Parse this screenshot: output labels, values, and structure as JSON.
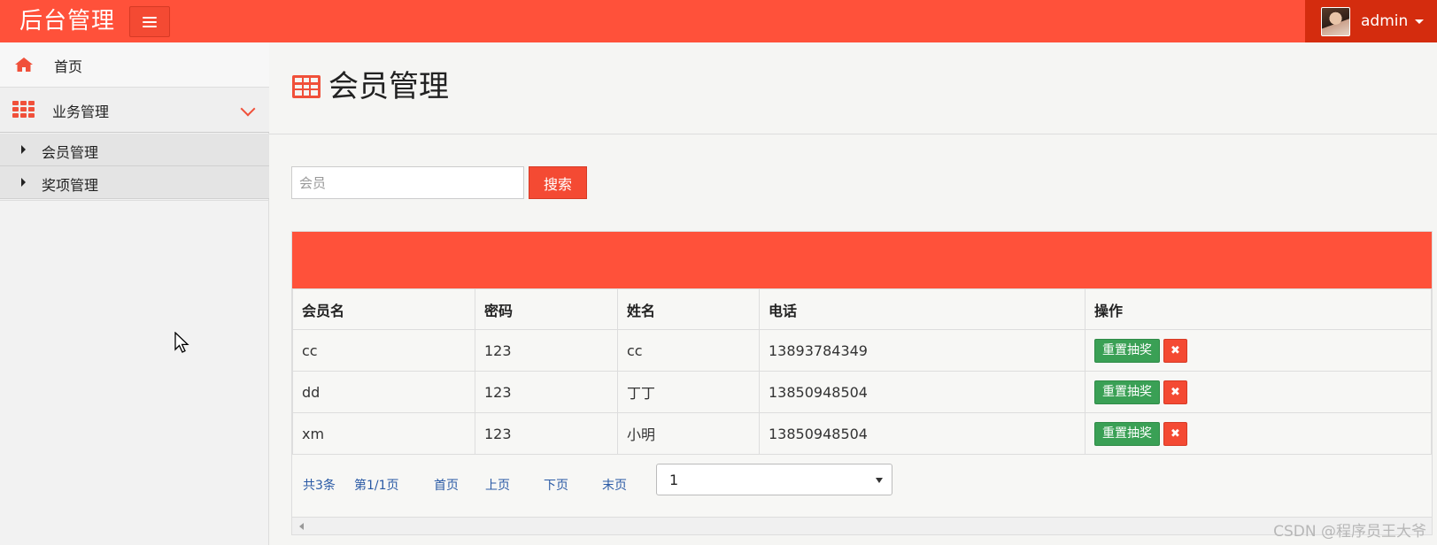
{
  "header": {
    "brand": "后台管理",
    "user_name": "admin"
  },
  "sidebar": {
    "home_label": "首页",
    "biz_label": "业务管理",
    "sub_items": [
      {
        "label": "会员管理"
      },
      {
        "label": "奖项管理"
      }
    ]
  },
  "main": {
    "page_title": "会员管理",
    "search": {
      "placeholder": "会员",
      "value": "",
      "button_label": "搜索"
    },
    "table": {
      "headers": [
        "会员名",
        "密码",
        "姓名",
        "电话",
        "操作"
      ],
      "rows": [
        {
          "username": "cc",
          "password": "123",
          "name": "cc",
          "phone": "13893784349"
        },
        {
          "username": "dd",
          "password": "123",
          "name": "丁丁",
          "phone": "13850948504"
        },
        {
          "username": "xm",
          "password": "123",
          "name": "小明",
          "phone": "13850948504"
        }
      ],
      "reset_label": "重置抽奖",
      "delete_symbol": "✖"
    },
    "pager": {
      "total": "共3条",
      "page_info": "第1/1页",
      "first": "首页",
      "prev": "上页",
      "next": "下页",
      "last": "末页",
      "selected_page": "1"
    }
  },
  "watermark": "CSDN @程序员王大爷",
  "colors": {
    "primary": "#ff513a",
    "user_area": "#d42c0e",
    "success": "#3aa055",
    "link": "#2a5aa5"
  },
  "icons": {
    "menu": "menu-icon",
    "home": "home-icon",
    "grid": "grid-icon",
    "chevron": "chevron-down-icon",
    "table": "table-icon",
    "delete": "close-icon"
  }
}
